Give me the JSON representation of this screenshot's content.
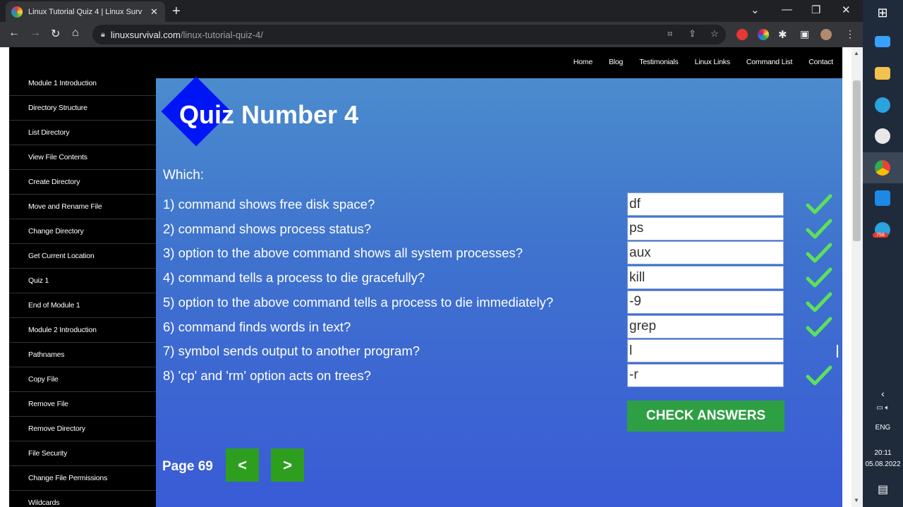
{
  "browser": {
    "tab_title": "Linux Tutorial Quiz 4 | Linux Surv",
    "url_host": "linuxsurvival.com",
    "url_path": "/linux-tutorial-quiz-4/"
  },
  "topnav": [
    "Home",
    "Blog",
    "Testimonials",
    "Linux Links",
    "Command List",
    "Contact"
  ],
  "sidebar": [
    "Module 1 Introduction",
    "Directory Structure",
    "List Directory",
    "View File Contents",
    "Create Directory",
    "Move and Rename File",
    "Change Directory",
    "Get Current Location",
    "Quiz 1",
    "End of Module 1",
    "Module 2 Introduction",
    "Pathnames",
    "Copy File",
    "Remove File",
    "Remove Directory",
    "File Security",
    "Change File Permissions",
    "Wildcards"
  ],
  "quiz": {
    "title": "Quiz Number 4",
    "prompt": "Which:",
    "questions": [
      {
        "text": "1) command shows free disk space?",
        "answer": "df",
        "correct": true
      },
      {
        "text": "2) command shows process status?",
        "answer": "ps",
        "correct": true
      },
      {
        "text": "3) option to the above command shows all system processes?",
        "answer": "aux",
        "correct": true
      },
      {
        "text": "4) command tells a process to die gracefully?",
        "answer": "kill",
        "correct": true
      },
      {
        "text": "5) option to the above command tells a process to die immediately?",
        "answer": "-9",
        "correct": true
      },
      {
        "text": "6) command finds words in text?",
        "answer": "grep",
        "correct": true
      },
      {
        "text": "7) symbol sends output to another program?",
        "answer": "l",
        "correct": false
      },
      {
        "text": "8) 'cp' and 'rm' option acts on trees?",
        "answer": "-r",
        "correct": true
      }
    ],
    "check_label": "CHECK ANSWERS",
    "page_label": "Page 69",
    "prev_label": "<",
    "next_label": ">"
  },
  "taskbar": {
    "lang": "ENG",
    "time": "20:11",
    "date": "05.08.2022",
    "badge": "758"
  },
  "colors": {
    "check": "#5de05a",
    "button_green": "#2ea043",
    "diamond": "#0015f5"
  }
}
